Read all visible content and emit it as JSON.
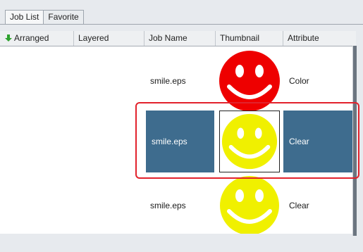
{
  "tabs": [
    {
      "label": "Job List",
      "active": true
    },
    {
      "label": "Favorite",
      "active": false
    }
  ],
  "columns": [
    "Arranged",
    "Layered",
    "Job Name",
    "Thumbnail",
    "Attribute"
  ],
  "rows": [
    {
      "job_name": "smile.eps",
      "thumbnail": "red-smiley-icon",
      "attribute": "Color",
      "selected": false
    },
    {
      "job_name": "smile.eps",
      "thumbnail": "yellow-smiley-icon",
      "attribute": "Clear",
      "selected": true
    },
    {
      "job_name": "smile.eps",
      "thumbnail": "yellow-smiley-icon",
      "attribute": "Clear",
      "selected": false
    }
  ],
  "colors": {
    "selection": "#3e6c8e",
    "highlight_border": "#e2222c",
    "smiley_red": "#ee0000",
    "smiley_yellow": "#f0f000"
  }
}
